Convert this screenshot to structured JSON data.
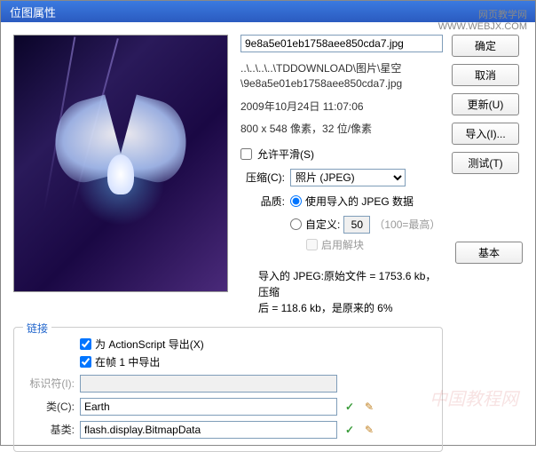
{
  "window": {
    "title": "位图属性"
  },
  "watermark": {
    "line1": "网页教学网",
    "line2": "WWW.WEBJX.COM",
    "bottom": "中国教程网"
  },
  "file": {
    "name": "9e8a5e01eb1758aee850cda7.jpg",
    "path_line1": "..\\..\\..\\..\\TDDOWNLOAD\\图片\\星空",
    "path_line2": "\\9e8a5e01eb1758aee850cda7.jpg",
    "date": "2009年10月24日  11:07:06",
    "dimensions": "800 x 548 像素，32 位/像素"
  },
  "options": {
    "smoothing_label": "允许平滑(S)",
    "compression_label": "压缩(C):",
    "compression_value": "照片 (JPEG)",
    "quality_label": "品质:",
    "use_imported_label": "使用导入的 JPEG 数据",
    "custom_label": "自定义:",
    "custom_value": "50",
    "custom_hint": "（100=最高）",
    "deblocking_label": "启用解块"
  },
  "summary": {
    "line1": "导入的 JPEG:原始文件 = 1753.6 kb，压缩",
    "line2": "后 = 118.6 kb，是原来的 6%"
  },
  "buttons": {
    "ok": "确定",
    "cancel": "取消",
    "update": "更新(U)",
    "import": "导入(I)...",
    "test": "测试(T)",
    "basic": "基本"
  },
  "link": {
    "legend": "链接",
    "export_as_label": "为 ActionScript 导出(X)",
    "export_frame1_label": "在帧 1 中导出",
    "identifier_label": "标识符(I):",
    "class_label": "类(C):",
    "class_value": "Earth",
    "baseclass_label": "基类:",
    "baseclass_value": "flash.display.BitmapData"
  }
}
